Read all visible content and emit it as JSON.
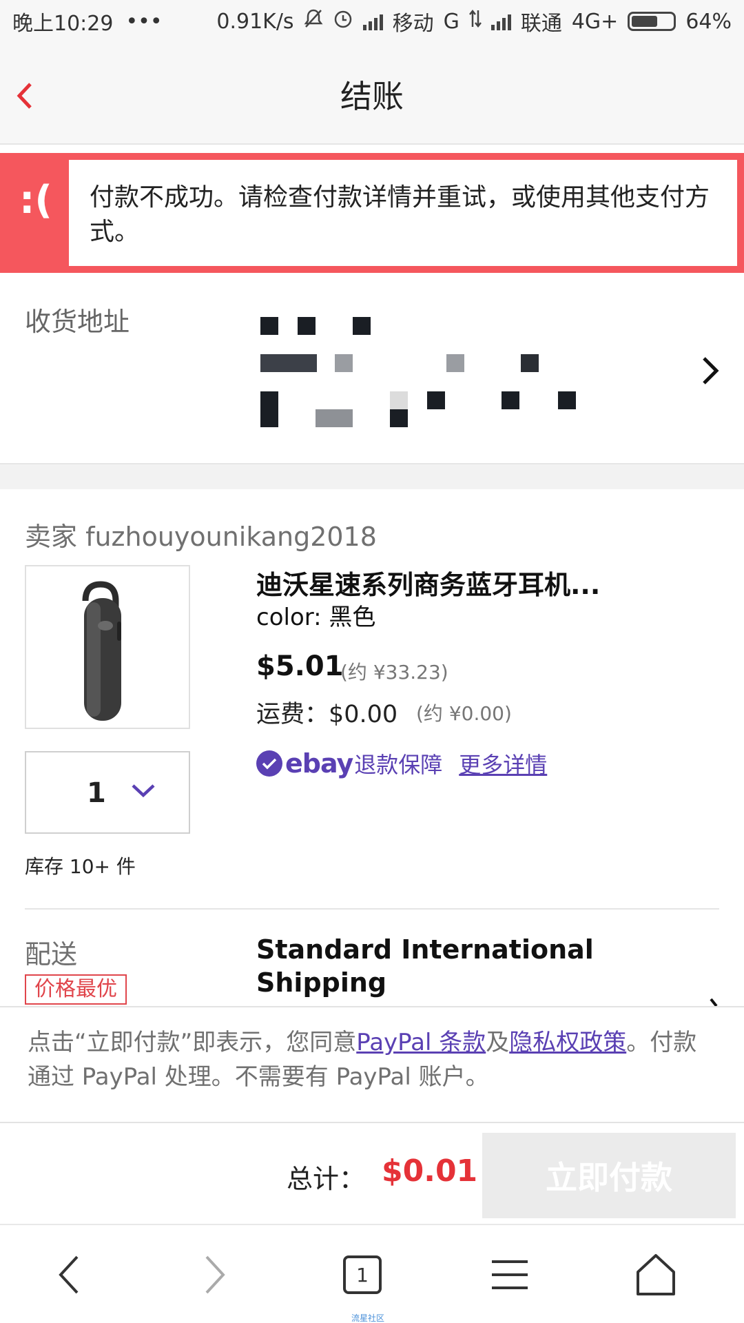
{
  "status_bar": {
    "time": "晚上10:29",
    "dots": "•••",
    "speed": "0.91K/s",
    "carrier1": "移动",
    "net1": "G",
    "carrier2": "联通",
    "net2": "4G+",
    "battery": "64%",
    "battery_level": 0.64
  },
  "header": {
    "title": "结账",
    "back_icon": "chevron-left-icon"
  },
  "error": {
    "face": ":(",
    "message": "付款不成功。请检查付款详情并重试，或使用其他支付方式。"
  },
  "address": {
    "label": "收货地址"
  },
  "seller": {
    "label": "卖家 fuzhouyounikang2018"
  },
  "item": {
    "title": "迪沃星速系列商务蓝牙耳机...",
    "variant": "color: 黑色",
    "price": "$5.01",
    "price_cny": "(约 ¥33.23)",
    "shipping": "运费：$0.00",
    "shipping_cny": "(约 ¥0.00)",
    "guarantee_brand": "ebay",
    "guarantee_text": "退款保障",
    "more_details": "更多详情",
    "quantity": "1",
    "stock": "库存 10+ 件"
  },
  "delivery": {
    "label": "配送",
    "badge": "价格最优",
    "method": "Standard International Shipping"
  },
  "terms": {
    "prefix": "点击“立即付款”即表示，您同意",
    "paypal_terms": "PayPal 条款",
    "and": "及",
    "privacy": "隐私权政策",
    "suffix": "。付款通过 PayPal 处理。不需要有 PayPal 账户。"
  },
  "total": {
    "label": "总计：",
    "value": "$0.01",
    "pay_button": "立即付款"
  },
  "browser_nav": {
    "tab_count": "1"
  },
  "watermark": "流星社区",
  "colors": {
    "error_red": "#f5575d",
    "price_red": "#e53238",
    "ebay_purple": "#5a40b3"
  }
}
